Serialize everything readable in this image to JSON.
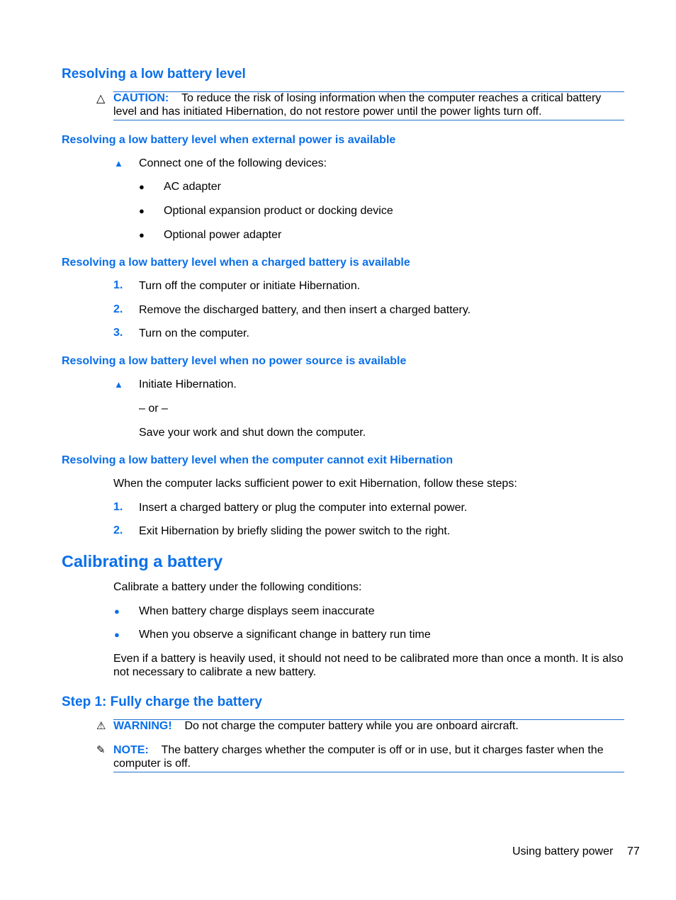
{
  "section1": {
    "title": "Resolving a low battery level",
    "caution": {
      "icon": "caution-triangle-outline-icon",
      "label": "CAUTION:",
      "line1": "To reduce the risk of losing information when the computer reaches a critical battery",
      "line2": "level and has initiated Hibernation, do not restore power until the power lights turn off."
    }
  },
  "sub1": {
    "title": "Resolving a low battery level when external power is available",
    "step": "Connect one of the following devices:",
    "items": [
      "AC adapter",
      "Optional expansion product or docking device",
      "Optional power adapter"
    ]
  },
  "sub2": {
    "title": "Resolving a low battery level when a charged battery is available",
    "steps": [
      {
        "num": "1.",
        "text": "Turn off the computer or initiate Hibernation."
      },
      {
        "num": "2.",
        "text": "Remove the discharged battery, and then insert a charged battery."
      },
      {
        "num": "3.",
        "text": "Turn on the computer."
      }
    ]
  },
  "sub3": {
    "title": "Resolving a low battery level when no power source is available",
    "step": "Initiate Hibernation.",
    "or": "– or –",
    "alt": "Save your work and shut down the computer."
  },
  "sub4": {
    "title": "Resolving a low battery level when the computer cannot exit Hibernation",
    "intro": "When the computer lacks sufficient power to exit Hibernation, follow these steps:",
    "steps": [
      {
        "num": "1.",
        "text": "Insert a charged battery or plug the computer into external power."
      },
      {
        "num": "2.",
        "text": "Exit Hibernation by briefly sliding the power switch to the right."
      }
    ]
  },
  "section2": {
    "title": "Calibrating a battery",
    "intro": "Calibrate a battery under the following conditions:",
    "items": [
      "When battery charge displays seem inaccurate",
      "When you observe a significant change in battery run time"
    ],
    "para_line1": "Even if a battery is heavily used, it should not need to be calibrated more than once a month. It is also",
    "para_line2": "not necessary to calibrate a new battery."
  },
  "step1": {
    "title": "Step 1: Fully charge the battery",
    "warning": {
      "icon": "warning-triangle-icon",
      "label": "WARNING!",
      "text": "Do not charge the computer battery while you are onboard aircraft."
    },
    "note": {
      "icon": "note-pad-icon",
      "label": "NOTE:",
      "line1": "The battery charges whether the computer is off or in use, but it charges faster when the",
      "line2": "computer is off."
    }
  },
  "footer": {
    "chapter": "Using battery power",
    "page": "77"
  }
}
